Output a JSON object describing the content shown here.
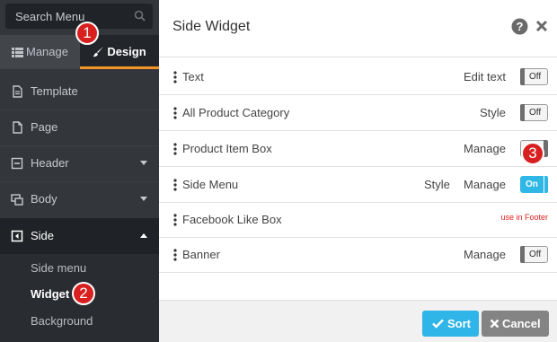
{
  "sidebar": {
    "search_placeholder": "Search Menu",
    "tabs": {
      "manage": "Manage",
      "design": "Design"
    },
    "items": {
      "template": "Template",
      "page": "Page",
      "header": "Header",
      "body": "Body",
      "side": "Side"
    },
    "subitems": {
      "side_menu": "Side menu",
      "widget": "Widget",
      "background": "Background"
    }
  },
  "badges": {
    "one": "1",
    "two": "2",
    "three": "3"
  },
  "main": {
    "title": "Side Widget",
    "rows": [
      {
        "label": "Text",
        "action1": "Edit text",
        "toggle": "Off"
      },
      {
        "label": "All Product Category",
        "action1": "Style",
        "toggle": "Off"
      },
      {
        "label": "Product Item Box",
        "action1": "Manage",
        "toggle": ""
      },
      {
        "label": "Side Menu",
        "action0": "Style",
        "action1": "Manage",
        "toggle": "On"
      },
      {
        "label": "Facebook Like Box",
        "note": "use in Footer"
      },
      {
        "label": "Banner",
        "action1": "Manage",
        "toggle": "Off"
      }
    ],
    "buttons": {
      "sort": "Sort",
      "cancel": "Cancel"
    }
  },
  "colors": {
    "sidebar_bg": "#33373c",
    "accent_orange": "#f29227",
    "toggle_on": "#2fb8e6",
    "badge_red": "#d7201f",
    "note_red": "#e02020",
    "cancel_gray": "#848484"
  },
  "icons": {
    "search": "search-icon",
    "list": "list-icon",
    "brush": "brush-icon",
    "help": "help-icon",
    "close": "close-icon",
    "drag": "drag-handle-icon",
    "check": "check-icon",
    "x": "x-icon"
  }
}
